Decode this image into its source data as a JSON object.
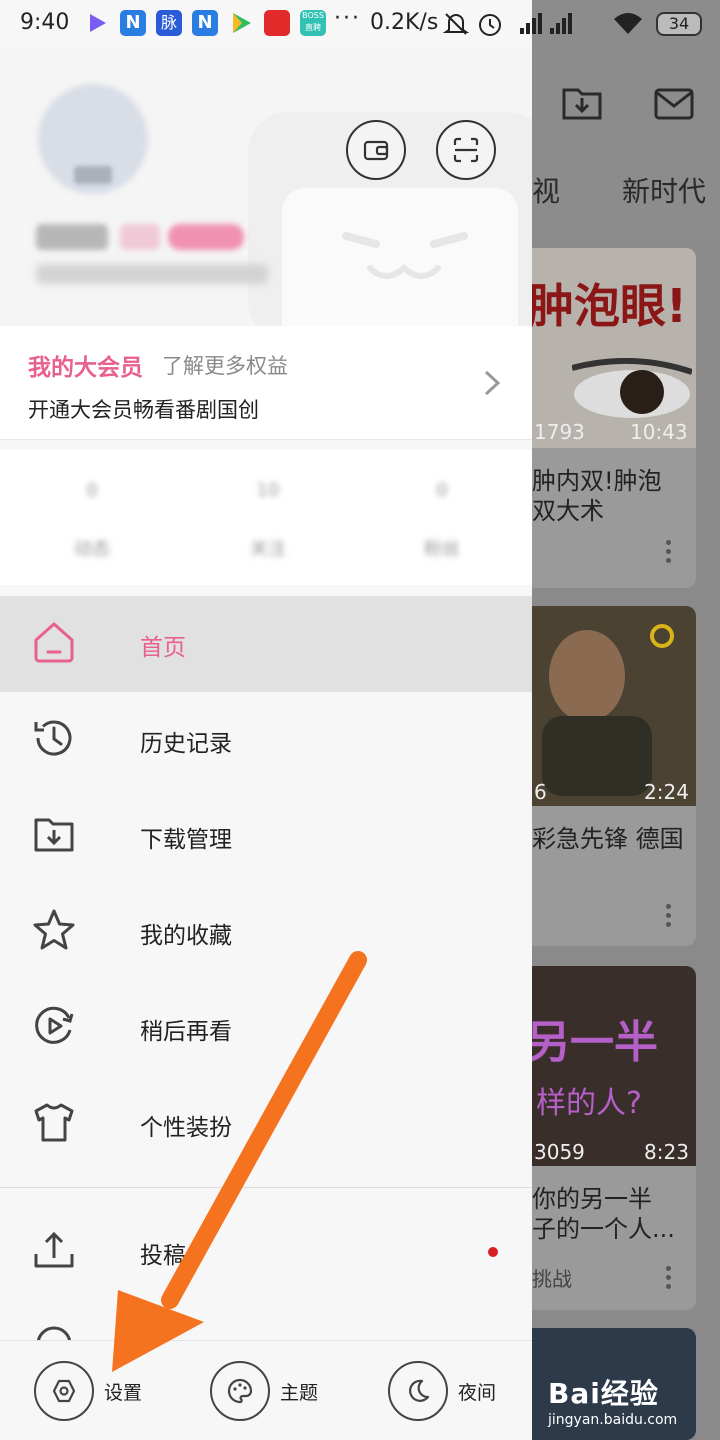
{
  "status_bar": {
    "time": "9:40",
    "net_speed": "0.2K/s",
    "battery": "34",
    "app_badges": [
      "脉"
    ]
  },
  "drawer": {
    "vip": {
      "title": "我的大会员",
      "subtitle": "了解更多权益",
      "description": "开通大会员畅看番剧国创"
    },
    "menu_items": [
      {
        "label": "首页",
        "icon": "home-icon",
        "active": true
      },
      {
        "label": "历史记录",
        "icon": "history-icon"
      },
      {
        "label": "下载管理",
        "icon": "download-folder-icon"
      },
      {
        "label": "我的收藏",
        "icon": "star-icon"
      },
      {
        "label": "稍后再看",
        "icon": "watch-later-icon"
      },
      {
        "label": "个性装扮",
        "icon": "tshirt-icon"
      },
      {
        "label": "投稿",
        "icon": "upload-icon"
      }
    ],
    "bottom_bar": {
      "settings": "设置",
      "theme": "主题",
      "night": "夜间"
    }
  },
  "feed": {
    "tabs": [
      "视",
      "新时代"
    ],
    "cards": [
      {
        "thumb_text": "肿泡眼!",
        "views": "1793",
        "duration": "10:43",
        "title": "肿内双!肿泡\n双大术"
      },
      {
        "views": "6",
        "duration": "2:24",
        "title": "彩急先锋 德国"
      },
      {
        "thumb_text": "另一半",
        "thumb_sub": "样的人?",
        "views": "3059",
        "duration": "8:23",
        "title": "你的另一半\n子的一个人...",
        "meta": "挑战"
      }
    ]
  },
  "watermark": {
    "brand": "Bai经验",
    "url": "jingyan.baidu.com"
  },
  "colors": {
    "accent": "#e8608c",
    "arrow": "#f5721e",
    "notification_dot": "#d81f26"
  }
}
